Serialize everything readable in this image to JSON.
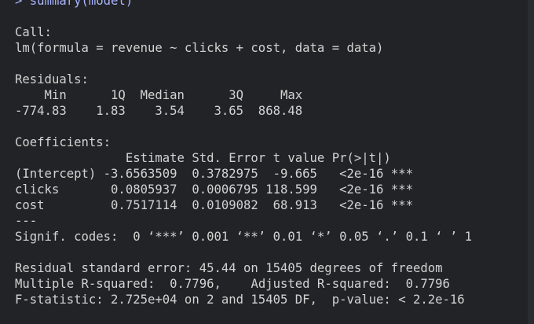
{
  "theme": {
    "background": "#222326",
    "text": "#d2d2d2",
    "command": "#a9b4ff"
  },
  "console": {
    "lines": [
      "> summary(model)",
      "Call:",
      "lm(formula = revenue ~ clicks + cost, data = data)",
      "Residuals:",
      "    Min      1Q  Median      3Q     Max ",
      "-774.83    1.83    3.54    3.65  868.48 ",
      "Coefficients:",
      "               Estimate Std. Error t value Pr(>|t|)    ",
      "(Intercept) -3.6563509  0.3782975  -9.665   <2e-16 ***",
      "clicks       0.0805937  0.0006795 118.599   <2e-16 ***",
      "cost         0.7517114  0.0109082  68.913   <2e-16 ***",
      "---",
      "Signif. codes:  0 ‘***’ 0.001 ‘**’ 0.01 ‘*’ 0.05 ‘.’ 0.1 ‘ ’ 1",
      "Residual standard error: 45.44 on 15405 degrees of freedom",
      "Multiple R-squared:  0.7796,\tAdjusted R-squared:  0.7796 ",
      "F-statistic: 2.725e+04 on 2 and 15405 DF,  p-value: < 2.2e-16"
    ]
  }
}
